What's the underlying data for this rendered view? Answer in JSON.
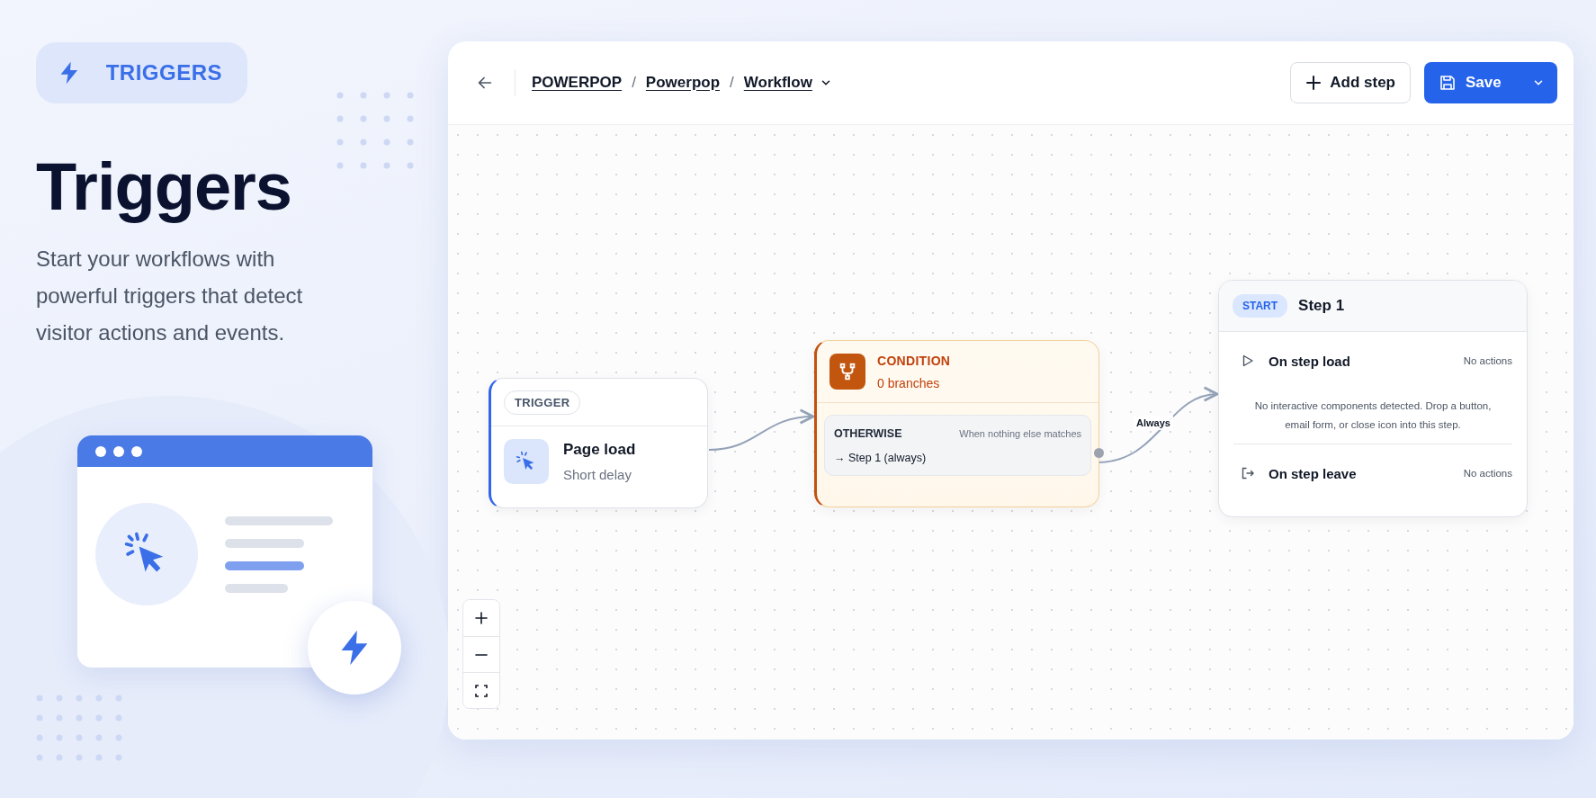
{
  "hero": {
    "badge": "TRIGGERS",
    "title": "Triggers",
    "subtitle": "Start your workflows with powerful triggers that detect visitor actions and events."
  },
  "header": {
    "breadcrumbs": [
      "POWERPOP",
      "Powerpop",
      "Workflow"
    ],
    "separator": "/",
    "add_step": "Add step",
    "save": "Save"
  },
  "nodes": [
    {
      "kind": "trigger",
      "tag": "TRIGGER",
      "title": "Page load",
      "subtitle": "Short delay"
    },
    {
      "kind": "condition",
      "title": "CONDITION",
      "subtitle": "0 branches",
      "branch": {
        "label": "OTHERWISE",
        "hint": "When nothing else matches",
        "target": "→ Step 1 (always)"
      }
    },
    {
      "kind": "step",
      "tag": "START",
      "title": "Step 1",
      "events": [
        {
          "kind": "load",
          "label": "On step load",
          "status": "No actions"
        },
        {
          "kind": "leave",
          "label": "On step leave",
          "status": "No actions"
        }
      ],
      "note": "No interactive components detected. Drop a button, email form, or close icon into this step."
    }
  ],
  "edge_label": "Always"
}
